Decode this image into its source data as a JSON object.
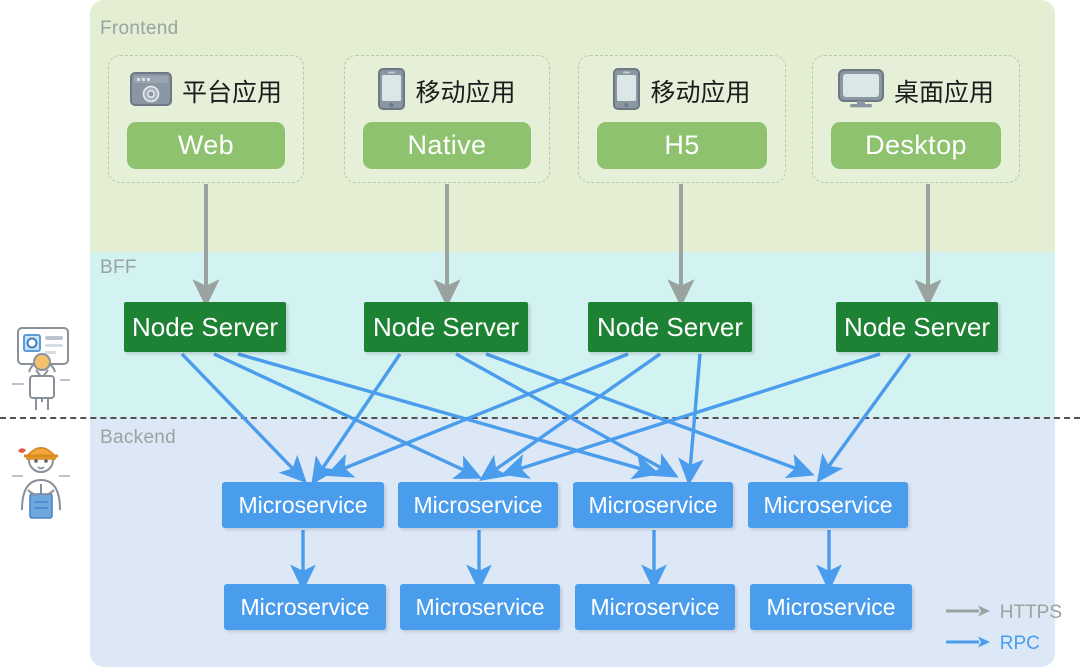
{
  "layers": [
    {
      "id": "frontend",
      "label": "Frontend",
      "bg": "#e3eed3"
    },
    {
      "id": "bff",
      "label": "BFF",
      "bg": "#d3f2f2"
    },
    {
      "id": "backend",
      "label": "Backend",
      "bg": "#dde8f7"
    }
  ],
  "frontend_cards": [
    {
      "icon": "browser-chrome-icon",
      "title": "平台应用",
      "tech": "Web"
    },
    {
      "icon": "mobile-phone-icon",
      "title": "移动应用",
      "tech": "Native"
    },
    {
      "icon": "mobile-phone-icon",
      "title": "移动应用",
      "tech": "H5"
    },
    {
      "icon": "desktop-monitor-icon",
      "title": "桌面应用",
      "tech": "Desktop"
    }
  ],
  "bff_nodes": [
    {
      "label": "Node Server"
    },
    {
      "label": "Node Server"
    },
    {
      "label": "Node Server"
    },
    {
      "label": "Node Server"
    }
  ],
  "backend_row_a": [
    {
      "label": "Microservice"
    },
    {
      "label": "Microservice"
    },
    {
      "label": "Microservice"
    },
    {
      "label": "Microservice"
    }
  ],
  "backend_row_b": [
    {
      "label": "Microservice"
    },
    {
      "label": "Microservice"
    },
    {
      "label": "Microservice"
    },
    {
      "label": "Microservice"
    }
  ],
  "legend": [
    {
      "label": "HTTPS",
      "color": "#9aa3a0",
      "kind": "https-arrow-icon"
    },
    {
      "label": "RPC",
      "color": "#4a9cec",
      "kind": "rpc-arrow-icon"
    }
  ],
  "colors": {
    "frontend_band": "#e3eed3",
    "bff_band": "#d3f2f2",
    "backend_band": "#dde8f7",
    "tech_pill": "#8ec26f",
    "node_server": "#1e8234",
    "microservice": "#4a9cec",
    "https_arrow": "#9aa3a0",
    "rpc_arrow": "#4a9cec",
    "band_label": "#9aa3a0",
    "divider": "#4e5456"
  },
  "illustrations": [
    {
      "name": "person-presenting-card",
      "layer": "bff"
    },
    {
      "name": "person-working-engineer",
      "layer": "backend"
    }
  ]
}
